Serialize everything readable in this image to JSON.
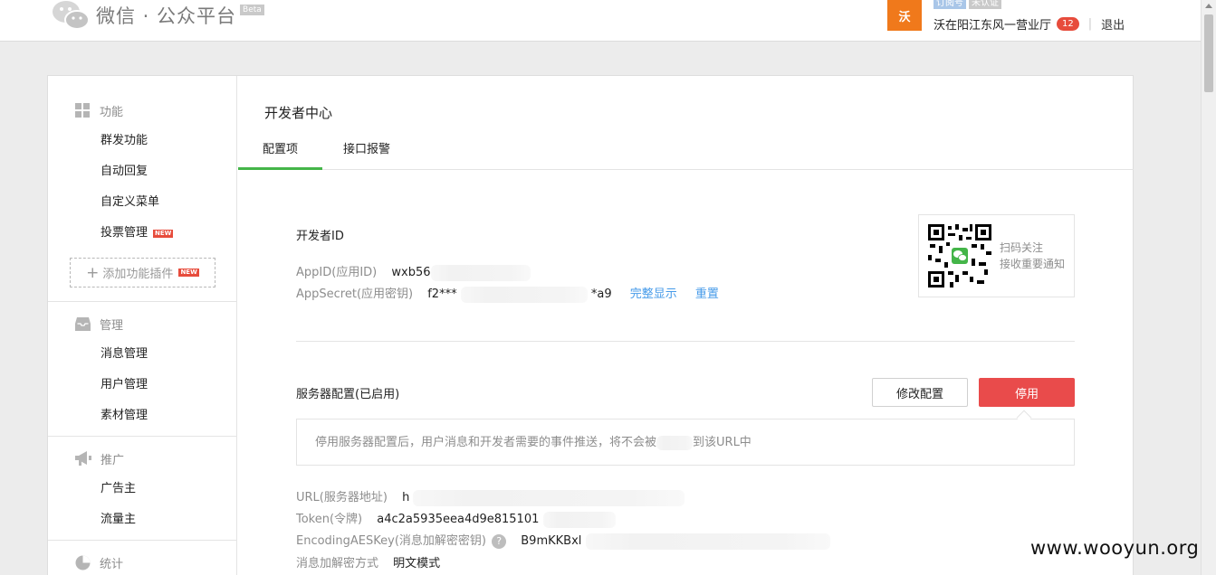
{
  "header": {
    "logo_text": "微信 · 公众平台",
    "beta_label": "Beta",
    "account": {
      "avatar_text": "沃",
      "tags": [
        "订阅号",
        "未认证"
      ],
      "name": "沃在阳江东风一营业厅",
      "badge_count": "12",
      "logout_label": "退出"
    }
  },
  "sidebar": {
    "sections": [
      {
        "title": "功能",
        "icon": "grid-icon",
        "items": [
          "群发功能",
          "自动回复",
          "自定义菜单",
          "投票管理"
        ]
      },
      {
        "title": "管理",
        "icon": "inbox-icon",
        "items": [
          "消息管理",
          "用户管理",
          "素材管理"
        ]
      },
      {
        "title": "推广",
        "icon": "megaphone-icon",
        "items": [
          "广告主",
          "流量主"
        ]
      },
      {
        "title": "统计",
        "icon": "pie-icon",
        "items": []
      }
    ],
    "new_tag": "NEW",
    "add_plugin_label": "添加功能插件"
  },
  "main": {
    "page_title": "开发者中心",
    "tabs": [
      {
        "label": "配置项",
        "active": true
      },
      {
        "label": "接口报警",
        "active": false
      }
    ],
    "developer_id": {
      "title": "开发者ID",
      "appid_label": "AppID(应用ID)",
      "appid_value": "wxb56",
      "secret_label": "AppSecret(应用密钥)",
      "secret_value_start": "f2***",
      "secret_value_end": "*a9",
      "show_full_link": "完整显示",
      "reset_link": "重置"
    },
    "qr": {
      "line1": "扫码关注",
      "line2": "接收重要通知"
    },
    "server": {
      "title": "服务器配置(已启用)",
      "edit_button": "修改配置",
      "stop_button": "停用",
      "tip_start": "停用服务器配置后，用户消息和开发者需要的事件推送，将不会被",
      "tip_end": "到该URL中",
      "url_label": "URL(服务器地址)",
      "url_value": "h",
      "token_label": "Token(令牌)",
      "token_value": "a4c2a5935eea4d9e815101",
      "aes_label": "EncodingAESKey(消息加解密密钥)",
      "aes_help": "?",
      "aes_value": "B9mKKBxl",
      "mode_label": "消息加解密方式",
      "mode_value": "明文模式"
    }
  },
  "watermark": "www.wooyun.org",
  "colors": {
    "accent_green": "#44b549",
    "danger_red": "#e94b4b",
    "link_blue": "#459ae9",
    "avatar_orange": "#f0791b"
  }
}
